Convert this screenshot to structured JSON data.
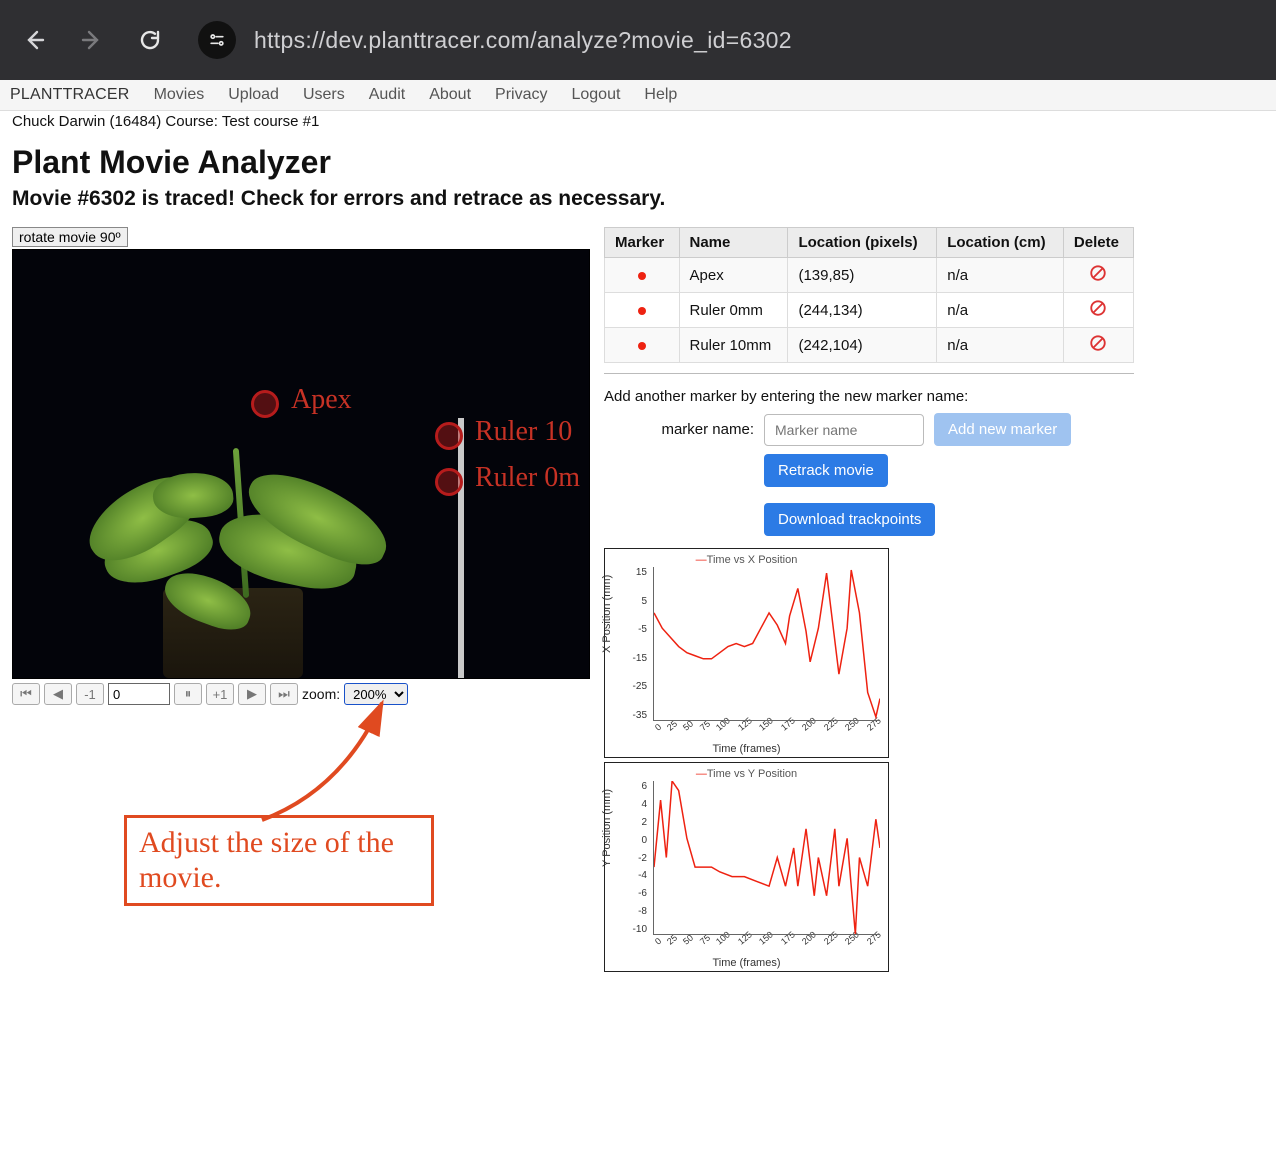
{
  "browser": {
    "url": "https://dev.planttracer.com/analyze?movie_id=6302"
  },
  "nav": {
    "brand": "PLANTTRACER",
    "items": [
      "Movies",
      "Upload",
      "Users",
      "Audit",
      "About",
      "Privacy",
      "Logout",
      "Help"
    ]
  },
  "user_line": "Chuck Darwin (16484) Course: Test course #1",
  "page_title": "Plant Movie Analyzer",
  "subtitle": "Movie #6302 is traced! Check for errors and retrace as necessary.",
  "rotate_label": "rotate movie 90º",
  "markers_on_movie": [
    {
      "name": "Apex",
      "x": 240,
      "y": 125
    },
    {
      "name": "Ruler 10",
      "x": 420,
      "y": 170
    },
    {
      "name": "Ruler 0m",
      "x": 420,
      "y": 215
    }
  ],
  "controls": {
    "minus1": "-1",
    "frame_value": "0",
    "plus1": "+1",
    "zoom_label": "zoom:",
    "zoom_value": "200%"
  },
  "annotation": "Adjust the size of the movie.",
  "marker_table": {
    "headers": [
      "Marker",
      "Name",
      "Location (pixels)",
      "Location (cm)",
      "Delete"
    ],
    "rows": [
      {
        "name": "Apex",
        "px": "(139,85)",
        "cm": "n/a"
      },
      {
        "name": "Ruler 0mm",
        "px": "(244,134)",
        "cm": "n/a"
      },
      {
        "name": "Ruler 10mm",
        "px": "(242,104)",
        "cm": "n/a"
      }
    ]
  },
  "add_marker": {
    "prompt": "Add another marker by entering the new marker name:",
    "label": "marker name:",
    "placeholder": "Marker name",
    "add_btn": "Add new marker",
    "retrack_btn": "Retrack movie",
    "download_btn": "Download trackpoints"
  },
  "chart_data": [
    {
      "type": "line",
      "title": "Time vs X Position",
      "xlabel": "Time (frames)",
      "ylabel": "X Position (mm)",
      "x_ticks": [
        0,
        25,
        50,
        75,
        100,
        125,
        150,
        175,
        200,
        225,
        250,
        275
      ],
      "y_ticks": [
        15,
        5,
        -5,
        -15,
        -25,
        -35
      ],
      "ylim": [
        -35,
        15
      ],
      "series": [
        {
          "name": "Time vs X Position",
          "color": "#e21",
          "x": [
            0,
            10,
            20,
            30,
            40,
            50,
            60,
            70,
            80,
            90,
            100,
            110,
            120,
            130,
            140,
            150,
            160,
            165,
            175,
            185,
            190,
            200,
            210,
            215,
            225,
            235,
            240,
            250,
            260,
            270,
            275
          ],
          "y": [
            0,
            -5,
            -8,
            -11,
            -13,
            -14,
            -15,
            -15,
            -13,
            -11,
            -10,
            -11,
            -10,
            -5,
            0,
            -4,
            -10,
            -1,
            8,
            -6,
            -16,
            -5,
            13,
            2,
            -20,
            -5,
            14,
            0,
            -26,
            -34,
            -28
          ]
        }
      ]
    },
    {
      "type": "line",
      "title": "Time vs Y Position",
      "xlabel": "Time (frames)",
      "ylabel": "Y Position (mm)",
      "x_ticks": [
        0,
        25,
        50,
        75,
        100,
        125,
        150,
        175,
        200,
        225,
        250,
        275
      ],
      "y_ticks": [
        6,
        4,
        2,
        0,
        -2,
        -4,
        -6,
        -8,
        -10
      ],
      "ylim": [
        -10,
        6
      ],
      "series": [
        {
          "name": "Time vs Y Position",
          "color": "#e21",
          "x": [
            0,
            8,
            15,
            22,
            30,
            40,
            50,
            60,
            70,
            80,
            95,
            110,
            125,
            140,
            150,
            160,
            170,
            175,
            185,
            195,
            200,
            210,
            220,
            225,
            235,
            245,
            250,
            260,
            270,
            275
          ],
          "y": [
            -3,
            4,
            -2,
            6,
            5,
            0,
            -3,
            -3,
            -3,
            -3.5,
            -4,
            -4,
            -4.5,
            -5,
            -2,
            -5,
            -1,
            -5,
            1,
            -6,
            -2,
            -6,
            1,
            -5,
            0,
            -10,
            -2,
            -5,
            2,
            -1
          ]
        }
      ]
    }
  ]
}
